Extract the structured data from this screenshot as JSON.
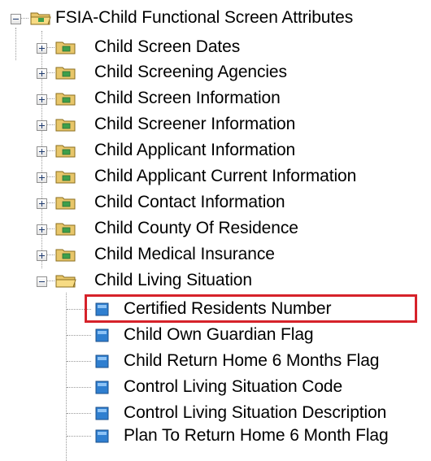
{
  "tree": {
    "root": {
      "label": "FSIA-Child Functional Screen Attributes",
      "icon": "folder-icon",
      "expanded": true
    },
    "folders": [
      {
        "label": "Child Screen Dates",
        "expanded": false
      },
      {
        "label": "Child Screening Agencies",
        "expanded": false
      },
      {
        "label": "Child Screen Information",
        "expanded": false
      },
      {
        "label": "Child Screener Information",
        "expanded": false
      },
      {
        "label": "Child Applicant Information",
        "expanded": false
      },
      {
        "label": "Child Applicant Current Information",
        "expanded": false
      },
      {
        "label": "Child Contact Information",
        "expanded": false
      },
      {
        "label": "Child County Of Residence",
        "expanded": false
      },
      {
        "label": "Child Medical Insurance",
        "expanded": false
      },
      {
        "label": "Child Living Situation",
        "expanded": true
      }
    ],
    "items": [
      {
        "label": "Certified Residents Number",
        "highlighted": true
      },
      {
        "label": "Child Own Guardian Flag",
        "highlighted": false
      },
      {
        "label": "Child Return Home 6 Months Flag",
        "highlighted": false
      },
      {
        "label": "Control Living Situation Code",
        "highlighted": false
      },
      {
        "label": "Control Living Situation Description",
        "highlighted": false
      },
      {
        "label": "Plan To Return Home 6 Month Flag",
        "highlighted": false
      }
    ],
    "colors": {
      "highlight_border": "#d6222a",
      "folder_fill": "#e8c66a",
      "item_icon": "#2f7fd0"
    }
  }
}
